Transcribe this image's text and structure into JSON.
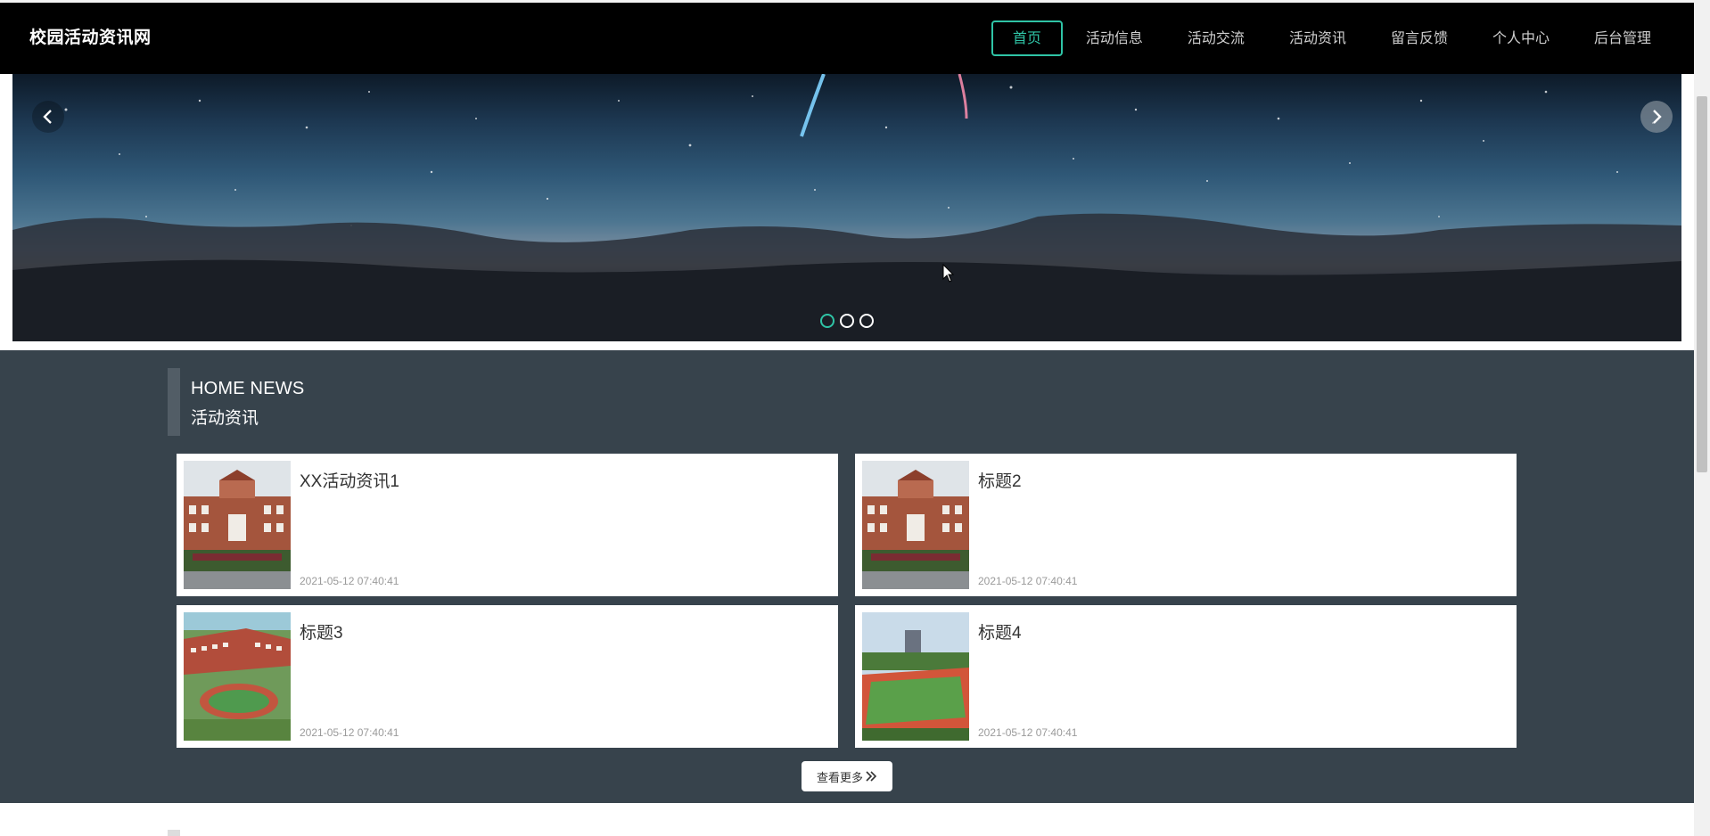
{
  "brand": {
    "title": "校园活动资讯网"
  },
  "nav": {
    "items": [
      {
        "label": "首页",
        "active": true
      },
      {
        "label": "活动信息"
      },
      {
        "label": "活动交流"
      },
      {
        "label": "活动资讯"
      },
      {
        "label": "留言反馈"
      },
      {
        "label": "个人中心"
      },
      {
        "label": "后台管理"
      }
    ]
  },
  "banner": {
    "prev_icon": "chevron-left-icon",
    "next_icon": "chevron-right-icon",
    "slide_count": 3,
    "active_slide": 1
  },
  "news": {
    "heading_en": "HOME NEWS",
    "heading_cn": "活动资讯",
    "items": [
      {
        "title": "XX活动资讯1",
        "date": "2021-05-12 07:40:41"
      },
      {
        "title": "标题2",
        "date": "2021-05-12 07:40:41"
      },
      {
        "title": "标题3",
        "date": "2021-05-12 07:40:41"
      },
      {
        "title": "标题4",
        "date": "2021-05-12 07:40:41"
      }
    ],
    "more_label": "查看更多",
    "more_icon": "double-chevron-right-icon"
  },
  "colors": {
    "accent": "#2fc4a6",
    "navbar_bg": "#000000",
    "section_bg": "#37434c"
  }
}
